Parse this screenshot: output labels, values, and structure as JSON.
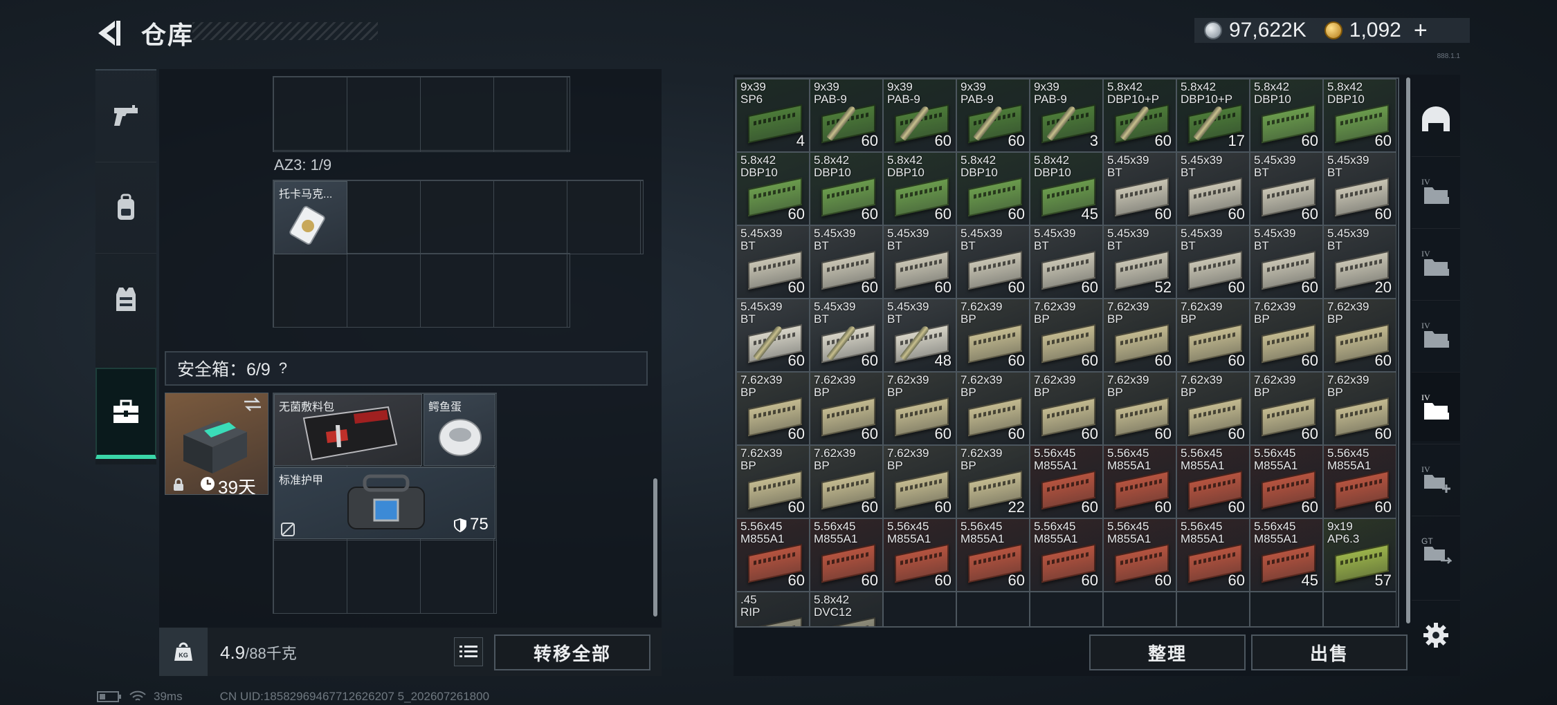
{
  "header": {
    "title": "仓库",
    "currency": [
      {
        "icon": "silver-coin-icon",
        "value": "97,622K"
      },
      {
        "icon": "gold-coin-icon",
        "value": "1,092"
      }
    ],
    "add_symbol": "+",
    "version": "888.1.1"
  },
  "left_tabs": [
    {
      "name": "weapons",
      "icon": "pistol-icon",
      "active": false
    },
    {
      "name": "backpack",
      "icon": "backpack-icon",
      "active": false
    },
    {
      "name": "vest",
      "icon": "vest-icon",
      "active": false
    },
    {
      "name": "safe-box",
      "icon": "toolbox-icon",
      "active": true
    }
  ],
  "az3": {
    "label": "AZ3: 1/9",
    "item_name": "托卡马克..."
  },
  "safe_box": {
    "label": "安全箱：6/9",
    "help": "?",
    "timer": "39天",
    "items": [
      {
        "name": "无菌敷料包"
      },
      {
        "name": "鳄鱼蛋"
      },
      {
        "name": "标准护甲",
        "durability": "75"
      }
    ]
  },
  "weight": {
    "kg_icon": "KG",
    "current": "4.9",
    "max": "/88千克"
  },
  "buttons": {
    "transfer_all": "转移全部",
    "sort": "整理",
    "sell": "出售"
  },
  "stash": {
    "columns": 9,
    "rows": [
      [
        {
          "label": "9x39\nSP6",
          "count": "4",
          "color": "#4c7a38"
        },
        {
          "label": "9x39\nPAB-9",
          "count": "60",
          "color": "#4c7a38",
          "bullet": true
        },
        {
          "label": "9x39\nPAB-9",
          "count": "60",
          "color": "#4c7a38",
          "bullet": true
        },
        {
          "label": "9x39\nPAB-9",
          "count": "60",
          "color": "#4c7a38",
          "bullet": true
        },
        {
          "label": "9x39\nPAB-9",
          "count": "3",
          "color": "#4c7a38",
          "bullet": true
        },
        {
          "label": "5.8x42\nDBP10+P",
          "count": "60",
          "color": "#4c7a38",
          "bullet": true
        },
        {
          "label": "5.8x42\nDBP10+P",
          "count": "17",
          "color": "#4c7a38",
          "bullet": true
        },
        {
          "label": "5.8x42\nDBP10",
          "count": "60",
          "color": "#6a9a4c"
        },
        {
          "label": "5.8x42\nDBP10",
          "count": "60",
          "color": "#6a9a4c"
        }
      ],
      [
        {
          "label": "5.8x42\nDBP10",
          "count": "60",
          "color": "#6a9a4c"
        },
        {
          "label": "5.8x42\nDBP10",
          "count": "60",
          "color": "#6a9a4c"
        },
        {
          "label": "5.8x42\nDBP10",
          "count": "60",
          "color": "#6a9a4c"
        },
        {
          "label": "5.8x42\nDBP10",
          "count": "60",
          "color": "#6a9a4c"
        },
        {
          "label": "5.8x42\nDBP10",
          "count": "45",
          "color": "#6a9a4c"
        },
        {
          "label": "5.45x39\nBT",
          "count": "60",
          "color": "#c7c3b2"
        },
        {
          "label": "5.45x39\nBT",
          "count": "60",
          "color": "#c7c3b2"
        },
        {
          "label": "5.45x39\nBT",
          "count": "60",
          "color": "#c7c3b2"
        },
        {
          "label": "5.45x39\nBT",
          "count": "60",
          "color": "#c7c3b2"
        }
      ],
      [
        {
          "label": "5.45x39\nBT",
          "count": "60",
          "color": "#c7c3b2"
        },
        {
          "label": "5.45x39\nBT",
          "count": "60",
          "color": "#c7c3b2"
        },
        {
          "label": "5.45x39\nBT",
          "count": "60",
          "color": "#c7c3b2"
        },
        {
          "label": "5.45x39\nBT",
          "count": "60",
          "color": "#c7c3b2"
        },
        {
          "label": "5.45x39\nBT",
          "count": "60",
          "color": "#c7c3b2"
        },
        {
          "label": "5.45x39\nBT",
          "count": "52",
          "color": "#c7c3b2"
        },
        {
          "label": "5.45x39\nBT",
          "count": "60",
          "color": "#c7c3b2"
        },
        {
          "label": "5.45x39\nBT",
          "count": "60",
          "color": "#c7c3b2"
        },
        {
          "label": "5.45x39\nBT",
          "count": "20",
          "color": "#c7c3b2"
        }
      ],
      [
        {
          "label": "5.45x39\nBT",
          "count": "60",
          "color": "#d6d3c6",
          "bullet": true
        },
        {
          "label": "5.45x39\nBT",
          "count": "60",
          "color": "#d6d3c6",
          "bullet": true
        },
        {
          "label": "5.45x39\nBT",
          "count": "48",
          "color": "#d6d3c6",
          "bullet": true
        },
        {
          "label": "7.62x39\nBP",
          "count": "60",
          "color": "#c2b98f"
        },
        {
          "label": "7.62x39\nBP",
          "count": "60",
          "color": "#c2b98f"
        },
        {
          "label": "7.62x39\nBP",
          "count": "60",
          "color": "#c2b98f"
        },
        {
          "label": "7.62x39\nBP",
          "count": "60",
          "color": "#c2b98f"
        },
        {
          "label": "7.62x39\nBP",
          "count": "60",
          "color": "#c2b98f"
        },
        {
          "label": "7.62x39\nBP",
          "count": "60",
          "color": "#c2b98f"
        }
      ],
      [
        {
          "label": "7.62x39\nBP",
          "count": "60",
          "color": "#c2b98f"
        },
        {
          "label": "7.62x39\nBP",
          "count": "60",
          "color": "#c2b98f"
        },
        {
          "label": "7.62x39\nBP",
          "count": "60",
          "color": "#c2b98f"
        },
        {
          "label": "7.62x39\nBP",
          "count": "60",
          "color": "#c2b98f"
        },
        {
          "label": "7.62x39\nBP",
          "count": "60",
          "color": "#c2b98f"
        },
        {
          "label": "7.62x39\nBP",
          "count": "60",
          "color": "#c2b98f"
        },
        {
          "label": "7.62x39\nBP",
          "count": "60",
          "color": "#c2b98f"
        },
        {
          "label": "7.62x39\nBP",
          "count": "60",
          "color": "#c2b98f"
        },
        {
          "label": "7.62x39\nBP",
          "count": "60",
          "color": "#c2b98f"
        }
      ],
      [
        {
          "label": "7.62x39\nBP",
          "count": "60",
          "color": "#c2b98f"
        },
        {
          "label": "7.62x39\nBP",
          "count": "60",
          "color": "#c2b98f"
        },
        {
          "label": "7.62x39\nBP",
          "count": "60",
          "color": "#c2b98f"
        },
        {
          "label": "7.62x39\nBP",
          "count": "22",
          "color": "#c2b98f"
        },
        {
          "label": "5.56x45\nM855A1",
          "count": "60",
          "color": "#b4533f"
        },
        {
          "label": "5.56x45\nM855A1",
          "count": "60",
          "color": "#b4533f"
        },
        {
          "label": "5.56x45\nM855A1",
          "count": "60",
          "color": "#b4533f"
        },
        {
          "label": "5.56x45\nM855A1",
          "count": "60",
          "color": "#b4533f"
        },
        {
          "label": "5.56x45\nM855A1",
          "count": "60",
          "color": "#b4533f"
        }
      ],
      [
        {
          "label": "5.56x45\nM855A1",
          "count": "60",
          "color": "#b4533f"
        },
        {
          "label": "5.56x45\nM855A1",
          "count": "60",
          "color": "#b4533f"
        },
        {
          "label": "5.56x45\nM855A1",
          "count": "60",
          "color": "#b4533f"
        },
        {
          "label": "5.56x45\nM855A1",
          "count": "60",
          "color": "#b4533f"
        },
        {
          "label": "5.56x45\nM855A1",
          "count": "60",
          "color": "#b4533f"
        },
        {
          "label": "5.56x45\nM855A1",
          "count": "60",
          "color": "#b4533f"
        },
        {
          "label": "5.56x45\nM855A1",
          "count": "60",
          "color": "#b4533f"
        },
        {
          "label": "5.56x45\nM855A1",
          "count": "45",
          "color": "#b4533f"
        },
        {
          "label": "9x19\nAP6.3",
          "count": "57",
          "color": "#9ab24a"
        }
      ],
      [
        {
          "label": ".45\nRIP",
          "count": "",
          "color": "#8c8a78"
        },
        {
          "label": "5.8x42\nDVC12",
          "count": "",
          "color": "#8c8a78"
        }
      ]
    ]
  },
  "right_icons": [
    {
      "icon": "helmet-icon"
    },
    {
      "icon": "container-iv-1-icon"
    },
    {
      "icon": "container-iv-2-icon"
    },
    {
      "icon": "container-iv-3-icon"
    },
    {
      "icon": "container-iv-4-icon",
      "active": true
    },
    {
      "icon": "add-container-icon"
    },
    {
      "icon": "transfer-container-icon"
    }
  ],
  "status": {
    "ping": "39ms",
    "uid": "CN UID:18582969467712626207 5_202607261800"
  },
  "colors": {
    "accent": "#3ad6a8",
    "panel": "#10161c"
  }
}
